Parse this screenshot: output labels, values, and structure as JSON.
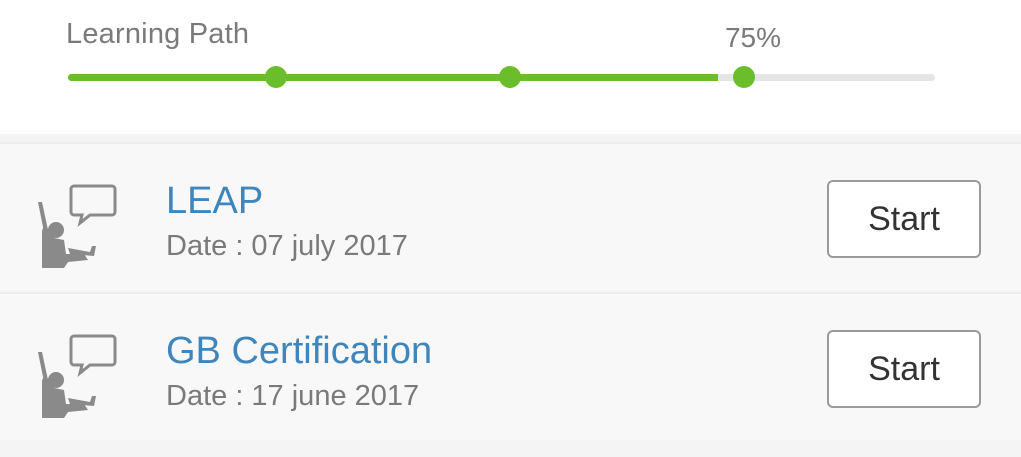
{
  "progress": {
    "title": "Learning Path",
    "percent_label": "75%",
    "percent_value": 0.75,
    "milestones": [
      0.24,
      0.51,
      0.78
    ],
    "accent_color": "#6cbd2c",
    "track_color": "#e5e5e5"
  },
  "courses": [
    {
      "title": "LEAP",
      "date": "Date : 07 july 2017",
      "icon": "presenter-speech-bubble-icon",
      "button_label": "Start"
    },
    {
      "title": "GB Certification",
      "date": "Date : 17 june 2017",
      "icon": "presenter-speech-bubble-icon",
      "button_label": "Start"
    }
  ],
  "colors": {
    "title_blue": "#3f86bd",
    "muted_text": "#7a7a7a"
  }
}
